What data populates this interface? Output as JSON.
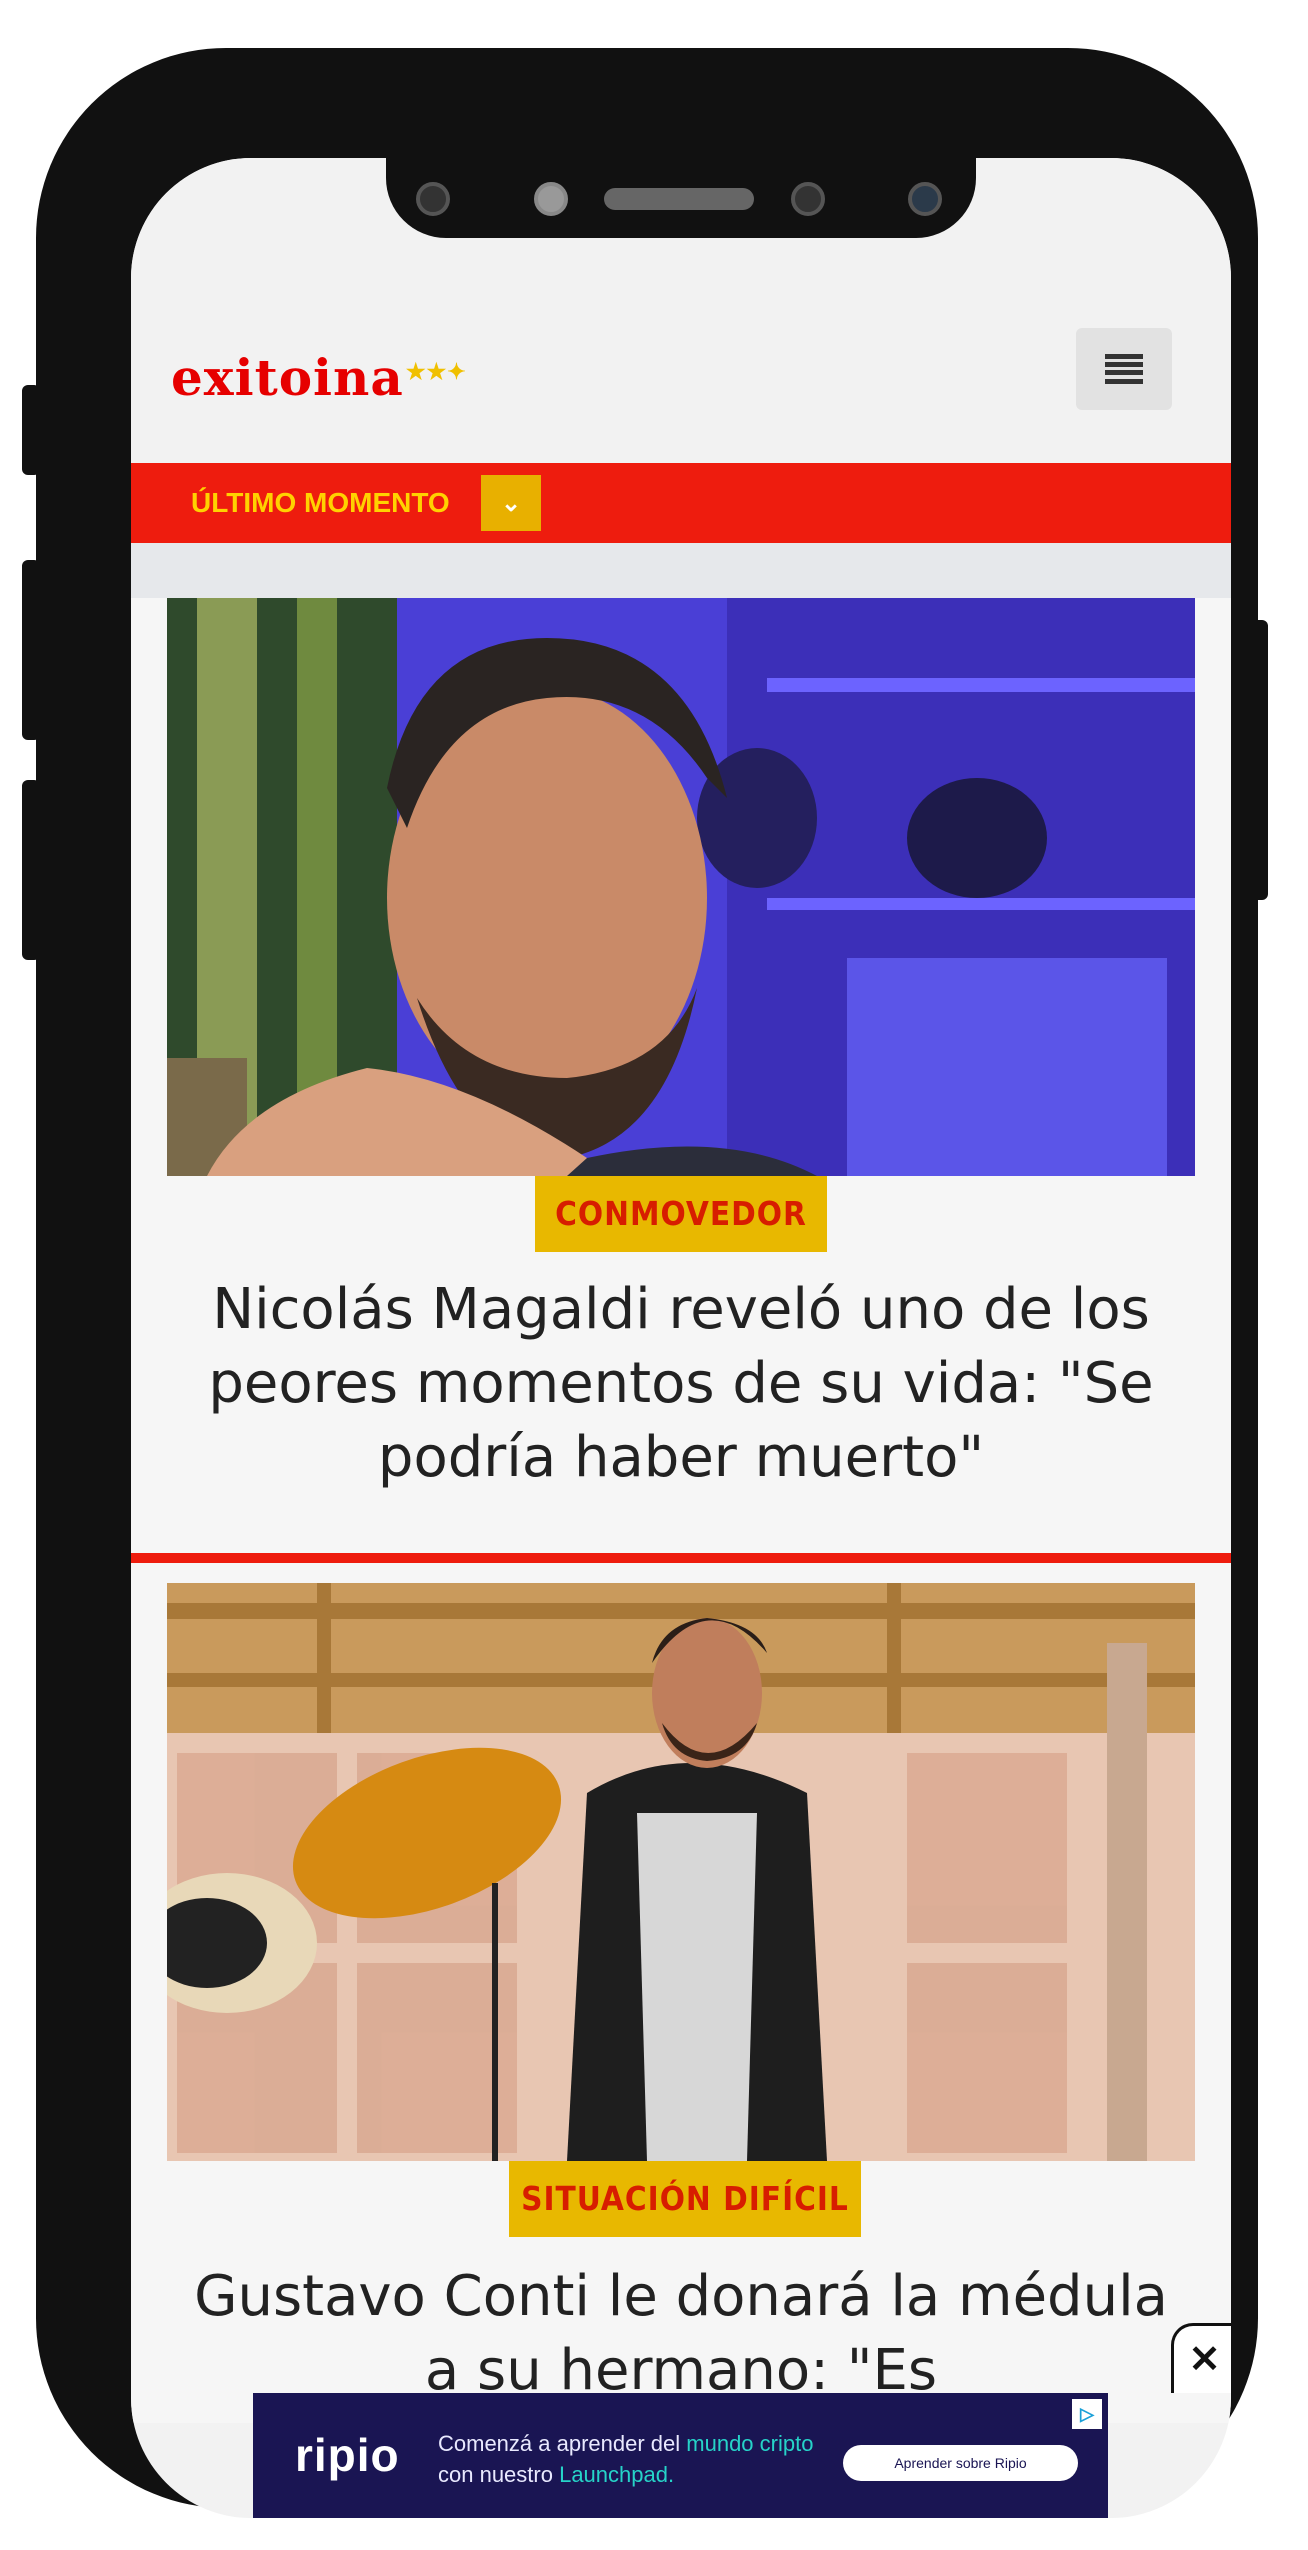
{
  "site": {
    "logo_text": "exitoina",
    "logo_stars": "★★✦",
    "menu_icon": "hamburger-menu-icon"
  },
  "breaking_bar": {
    "label": "ÚLTIMO MOMENTO",
    "toggle_glyph": "⌄",
    "colors": {
      "bar": "#ee1c0e",
      "label": "#ffd200",
      "toggle": "#e8b000"
    }
  },
  "articles": [
    {
      "category": "CONMOVEDOR",
      "headline": "Nicolás Magaldi reveló uno de los peores momentos de su vida: \"Se podría haber muerto\""
    },
    {
      "category": "SITUACIÓN DIFÍCIL",
      "headline": "Gustavo Conti le donará la médula a su hermano: \"Es"
    }
  ],
  "ad": {
    "brand": "ripio",
    "text_line1_a": "Comenzá a aprender del ",
    "text_line1_b": "mundo cripto",
    "text_line2_a": "con nuestro ",
    "text_line2_b": "Launchpad.",
    "cta": "Aprender sobre Ripio",
    "info_glyph": "▷",
    "close_glyph": "✕"
  },
  "colors": {
    "accent_red": "#ee1c0e",
    "badge_yellow": "#e8b800",
    "ad_bg": "#1a1553"
  }
}
